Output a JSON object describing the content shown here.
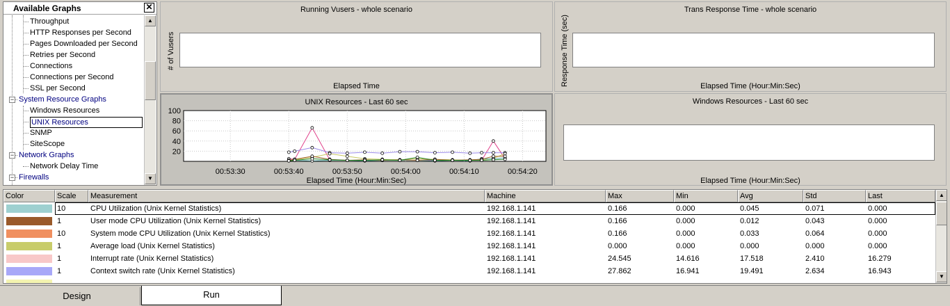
{
  "tree": {
    "title": "Available Graphs",
    "close_glyph": "✕",
    "items": [
      {
        "label": "Throughput",
        "group": false
      },
      {
        "label": "HTTP Responses per Second",
        "group": false
      },
      {
        "label": "Pages Downloaded per Second",
        "group": false
      },
      {
        "label": "Retries per Second",
        "group": false
      },
      {
        "label": "Connections",
        "group": false
      },
      {
        "label": "Connections per Second",
        "group": false
      },
      {
        "label": "SSL per Second",
        "group": false
      },
      {
        "label": "System Resource Graphs",
        "group": true
      },
      {
        "label": "Windows Resources",
        "group": false
      },
      {
        "label": "UNIX Resources",
        "group": false,
        "selected": true
      },
      {
        "label": "SNMP",
        "group": false
      },
      {
        "label": "SiteScope",
        "group": false
      },
      {
        "label": "Network Graphs",
        "group": true
      },
      {
        "label": "Network Delay Time",
        "group": false
      },
      {
        "label": "Firewalls",
        "group": true
      }
    ],
    "expander_minus": "−",
    "expander_plus": "+"
  },
  "graphs": {
    "running_vusers": {
      "title": "Running Vusers - whole scenario",
      "ylabel": "# of Vusers",
      "xlabel": "Elapsed Time"
    },
    "trans_response": {
      "title": "Trans Response Time - whole scenario",
      "ylabel": "Response Time (sec)",
      "xlabel": "Elapsed Time (Hour:Min:Sec)"
    },
    "unix_resources": {
      "title": "UNIX Resources - Last 60 sec",
      "xlabel": "Elapsed Time (Hour:Min:Sec)"
    },
    "windows_resources": {
      "title": "Windows Resources - Last 60 sec",
      "xlabel": "Elapsed Time (Hour:Min:Sec)"
    }
  },
  "chart_data": {
    "type": "line",
    "title": "UNIX Resources - Last 60 sec",
    "xlabel": "Elapsed Time (Hour:Min:Sec)",
    "ylabel": "",
    "ylim": [
      0,
      100
    ],
    "yticks": [
      "100",
      "80",
      "60",
      "40",
      "20"
    ],
    "xticks": [
      "00:53:30",
      "00:53:40",
      "00:53:50",
      "00:54:00",
      "00:54:10",
      "00:54:20"
    ],
    "x": [
      "00:53:40",
      "00:53:41",
      "00:53:44",
      "00:53:47",
      "00:53:50",
      "00:53:53",
      "00:53:56",
      "00:53:59",
      "00:54:02",
      "00:54:05",
      "00:54:08",
      "00:54:11",
      "00:54:13",
      "00:54:15",
      "00:54:17"
    ],
    "series": [
      {
        "name": "Interrupt rate",
        "color": "#e0408a",
        "values": [
          5,
          4,
          66,
          3,
          2,
          2,
          2,
          2,
          2,
          2,
          2,
          2,
          2,
          40,
          5
        ]
      },
      {
        "name": "Context switch rate",
        "color": "#9a8ae8",
        "values": [
          18,
          20,
          27,
          17,
          16,
          18,
          16,
          19,
          19,
          17,
          18,
          16,
          17,
          17,
          17
        ]
      },
      {
        "name": "Average load",
        "color": "#c8c860",
        "values": [
          2,
          3,
          8,
          15,
          10,
          5,
          4,
          3,
          5,
          4,
          3,
          2,
          3,
          6,
          15
        ]
      },
      {
        "name": "CPU Utilization",
        "color": "#60b0b0",
        "values": [
          1,
          2,
          1,
          2,
          2,
          1,
          2,
          2,
          2,
          1,
          2,
          1,
          5,
          5,
          7
        ]
      },
      {
        "name": "User mode CPU Utilization",
        "color": "#a0602a",
        "values": [
          2,
          4,
          10,
          4,
          2,
          3,
          2,
          3,
          2,
          4,
          2,
          3,
          4,
          10,
          10
        ]
      },
      {
        "name": "System mode CPU Utilization",
        "color": "#208020",
        "values": [
          1,
          2,
          5,
          3,
          2,
          2,
          3,
          2,
          8,
          2,
          2,
          2,
          2,
          3,
          4
        ]
      }
    ]
  },
  "table": {
    "headers": [
      "Color",
      "Scale",
      "Measurement",
      "Machine",
      "Max",
      "Min",
      "Avg",
      "Std",
      "Last"
    ],
    "rows": [
      {
        "color": "#9ed0d0",
        "scale": "10",
        "measurement": "CPU Utilization (Unix Kernel Statistics)",
        "machine": "192.168.1.141",
        "max": "0.166",
        "min": "0.000",
        "avg": "0.045",
        "std": "0.071",
        "last": "0.000"
      },
      {
        "color": "#9a5a2a",
        "scale": "1",
        "measurement": "User mode CPU Utilization (Unix Kernel Statistics)",
        "machine": "192.168.1.141",
        "max": "0.166",
        "min": "0.000",
        "avg": "0.012",
        "std": "0.043",
        "last": "0.000"
      },
      {
        "color": "#f09060",
        "scale": "10",
        "measurement": "System mode CPU Utilization (Unix Kernel Statistics)",
        "machine": "192.168.1.141",
        "max": "0.166",
        "min": "0.000",
        "avg": "0.033",
        "std": "0.064",
        "last": "0.000"
      },
      {
        "color": "#c8cc6a",
        "scale": "1",
        "measurement": "Average load (Unix Kernel Statistics)",
        "machine": "192.168.1.141",
        "max": "0.000",
        "min": "0.000",
        "avg": "0.000",
        "std": "0.000",
        "last": "0.000"
      },
      {
        "color": "#f8c8c8",
        "scale": "1",
        "measurement": "Interrupt rate (Unix Kernel Statistics)",
        "machine": "192.168.1.141",
        "max": "24.545",
        "min": "14.616",
        "avg": "17.518",
        "std": "2.410",
        "last": "16.279"
      },
      {
        "color": "#a8a8f8",
        "scale": "1",
        "measurement": "Context switch rate (Unix Kernel Statistics)",
        "machine": "192.168.1.141",
        "max": "27.862",
        "min": "16.941",
        "avg": "19.491",
        "std": "2.634",
        "last": "16.943"
      }
    ]
  },
  "tabs": {
    "design": "Design",
    "run": "Run"
  },
  "scroll": {
    "up": "▲",
    "down": "▼"
  }
}
